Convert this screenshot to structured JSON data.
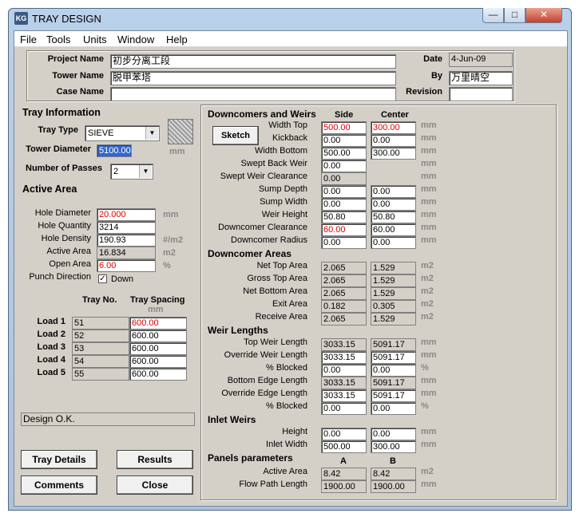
{
  "window": {
    "title": "TRAY DESIGN",
    "icon_text": "KG"
  },
  "menu": [
    "File",
    "Tools",
    "Units",
    "Window",
    "Help"
  ],
  "header": {
    "project_name_label": "Project Name",
    "project_name": "初步分离工段",
    "tower_name_label": "Tower Name",
    "tower_name": "脱甲苯塔",
    "case_name_label": "Case Name",
    "case_name": "",
    "date_label": "Date",
    "date": "4-Jun-09",
    "by_label": "By",
    "by": "万里晴空",
    "revision_label": "Revision",
    "revision": ""
  },
  "tray_info": {
    "title": "Tray Information",
    "tray_type_label": "Tray Type",
    "tray_type": "SIEVE",
    "tower_diameter_label": "Tower Diameter",
    "tower_diameter": "5100.00",
    "tower_diameter_unit": "mm",
    "passes_label": "Number of Passes",
    "passes": "2"
  },
  "active_area": {
    "title": "Active Area",
    "rows": [
      {
        "label": "Hole Diameter",
        "value": "20.000",
        "unit": "mm",
        "red": true
      },
      {
        "label": "Hole Quantity",
        "value": "3214",
        "unit": "",
        "red": false
      },
      {
        "label": "Hole Density",
        "value": "190.93",
        "unit": "#/m2",
        "red": false
      },
      {
        "label": "Active Area",
        "value": "16.834",
        "unit": "m2",
        "red": false,
        "ro": true
      },
      {
        "label": "Open Area",
        "value": "6.00",
        "unit": "%",
        "red": true
      }
    ],
    "punch_label": "Punch Direction",
    "punch_value": "Down"
  },
  "loads": {
    "col_tray": "Tray No.",
    "col_spacing": "Tray Spacing",
    "col_unit": "mm",
    "rows": [
      {
        "label": "Load 1",
        "tray": "51",
        "spacing": "600.00",
        "red": true
      },
      {
        "label": "Load 2",
        "tray": "52",
        "spacing": "600.00",
        "red": false
      },
      {
        "label": "Load 3",
        "tray": "53",
        "spacing": "600.00",
        "red": false
      },
      {
        "label": "Load 4",
        "tray": "54",
        "spacing": "600.00",
        "red": false
      },
      {
        "label": "Load 5",
        "tray": "55",
        "spacing": "600.00",
        "red": false
      }
    ]
  },
  "status": "Design O.K.",
  "buttons": {
    "tray_details": "Tray Details",
    "results": "Results",
    "comments": "Comments",
    "close": "Close",
    "sketch": "Sketch"
  },
  "downcomers": {
    "title": "Downcomers and Weirs",
    "col_side": "Side",
    "col_center": "Center",
    "rows": [
      {
        "label": "Width Top",
        "side": "500.00",
        "center": "300.00",
        "unit": "mm",
        "sred": true,
        "cred": true
      },
      {
        "label": "Kickback",
        "side": "0.00",
        "center": "0.00",
        "unit": "mm"
      },
      {
        "label": "Width Bottom",
        "side": "500.00",
        "center": "300.00",
        "unit": "mm"
      },
      {
        "label": "Swept Back Weir",
        "side": "0.00",
        "center": "",
        "unit": "mm"
      },
      {
        "label": "Swept Weir Clearance",
        "side": "0.00",
        "center": "",
        "unit": "mm",
        "sro": true
      },
      {
        "label": "Sump Depth",
        "side": "0.00",
        "center": "0.00",
        "unit": "mm"
      },
      {
        "label": "Sump Width",
        "side": "0.00",
        "center": "0.00",
        "unit": "mm"
      },
      {
        "label": "Weir Height",
        "side": "50.80",
        "center": "50.80",
        "unit": "mm"
      },
      {
        "label": "Downcomer Clearance",
        "side": "60.00",
        "center": "60.00",
        "unit": "mm",
        "sred": true
      },
      {
        "label": "Downcomer Radius",
        "side": "0.00",
        "center": "0.00",
        "unit": "mm"
      }
    ]
  },
  "dc_areas": {
    "title": "Downcomer Areas",
    "rows": [
      {
        "label": "Net Top Area",
        "side": "2.065",
        "center": "1.529",
        "unit": "m2"
      },
      {
        "label": "Gross Top Area",
        "side": "2.065",
        "center": "1.529",
        "unit": "m2"
      },
      {
        "label": "Net Bottom Area",
        "side": "2.065",
        "center": "1.529",
        "unit": "m2"
      },
      {
        "label": "Exit Area",
        "side": "0.182",
        "center": "0.305",
        "unit": "m2"
      },
      {
        "label": "Receive Area",
        "side": "2.065",
        "center": "1.529",
        "unit": "m2"
      }
    ]
  },
  "weir_lengths": {
    "title": "Weir Lengths",
    "rows": [
      {
        "label": "Top Weir Length",
        "side": "3033.15",
        "center": "5091.17",
        "unit": "mm",
        "ro": true
      },
      {
        "label": "Override Weir Length",
        "side": "3033.15",
        "center": "5091.17",
        "unit": "mm"
      },
      {
        "label": "% Blocked",
        "side": "0.00",
        "center": "0.00",
        "unit": "%"
      },
      {
        "label": "Bottom Edge Length",
        "side": "3033.15",
        "center": "5091.17",
        "unit": "mm",
        "ro": true
      },
      {
        "label": "Override Edge Length",
        "side": "3033.15",
        "center": "5091.17",
        "unit": "mm"
      },
      {
        "label": "% Blocked",
        "side": "0.00",
        "center": "0.00",
        "unit": "%"
      }
    ]
  },
  "inlet_weirs": {
    "title": "Inlet Weirs",
    "rows": [
      {
        "label": "Height",
        "side": "0.00",
        "center": "0.00",
        "unit": "mm"
      },
      {
        "label": "Inlet Width",
        "side": "500.00",
        "center": "300.00",
        "unit": "mm"
      }
    ]
  },
  "panels": {
    "title": "Panels parameters",
    "col_a": "A",
    "col_b": "B",
    "rows": [
      {
        "label": "Active Area",
        "side": "8.42",
        "center": "8.42",
        "unit": "m2"
      },
      {
        "label": "Flow Path Length",
        "side": "1900.00",
        "center": "1900.00",
        "unit": "mm"
      }
    ]
  }
}
